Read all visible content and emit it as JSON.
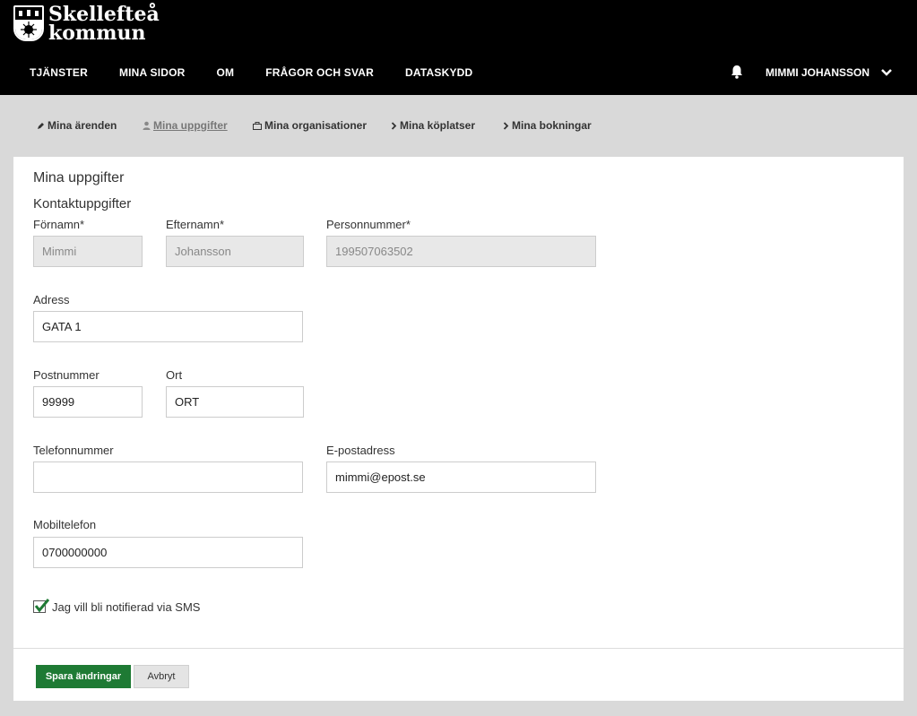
{
  "brand": {
    "line1": "Skellefteå",
    "line2": "kommun"
  },
  "topnav": {
    "items": [
      {
        "label": "TJÄNSTER"
      },
      {
        "label": "MINA SIDOR"
      },
      {
        "label": "OM"
      },
      {
        "label": "FRÅGOR OCH SVAR"
      },
      {
        "label": "DATASKYDD"
      }
    ]
  },
  "user": {
    "name": "MIMMI JOHANSSON"
  },
  "subnav": {
    "items": [
      {
        "label": "Mina ärenden",
        "icon": "pen-icon"
      },
      {
        "label": "Mina uppgifter",
        "icon": "person-icon",
        "active": true
      },
      {
        "label": "Mina organisationer",
        "icon": "briefcase-icon"
      },
      {
        "label": "Mina köplatser",
        "icon": "chevron-right-icon"
      },
      {
        "label": "Mina bokningar",
        "icon": "chevron-right-icon"
      }
    ]
  },
  "form": {
    "title": "Mina uppgifter",
    "section": "Kontaktuppgifter",
    "fornamn": {
      "label": "Förnamn*",
      "value": "Mimmi"
    },
    "efternamn": {
      "label": "Efternamn*",
      "value": "Johansson"
    },
    "personnummer": {
      "label": "Personnummer*",
      "value": "199507063502"
    },
    "adress": {
      "label": "Adress",
      "value": "GATA 1"
    },
    "postnummer": {
      "label": "Postnummer",
      "value": "99999"
    },
    "ort": {
      "label": "Ort",
      "value": "ORT"
    },
    "telefon": {
      "label": "Telefonnummer",
      "value": ""
    },
    "epost": {
      "label": "E-postadress",
      "value": "mimmi@epost.se"
    },
    "mobil": {
      "label": "Mobiltelefon",
      "value": "0700000000"
    },
    "sms": {
      "label": "Jag vill bli notifierad via SMS",
      "checked": true
    },
    "save_label": "Spara ändringar",
    "cancel_label": "Avbryt"
  },
  "colors": {
    "header_bg": "#000000",
    "primary": "#1e7a34",
    "page_bg": "#d9d9d9"
  }
}
